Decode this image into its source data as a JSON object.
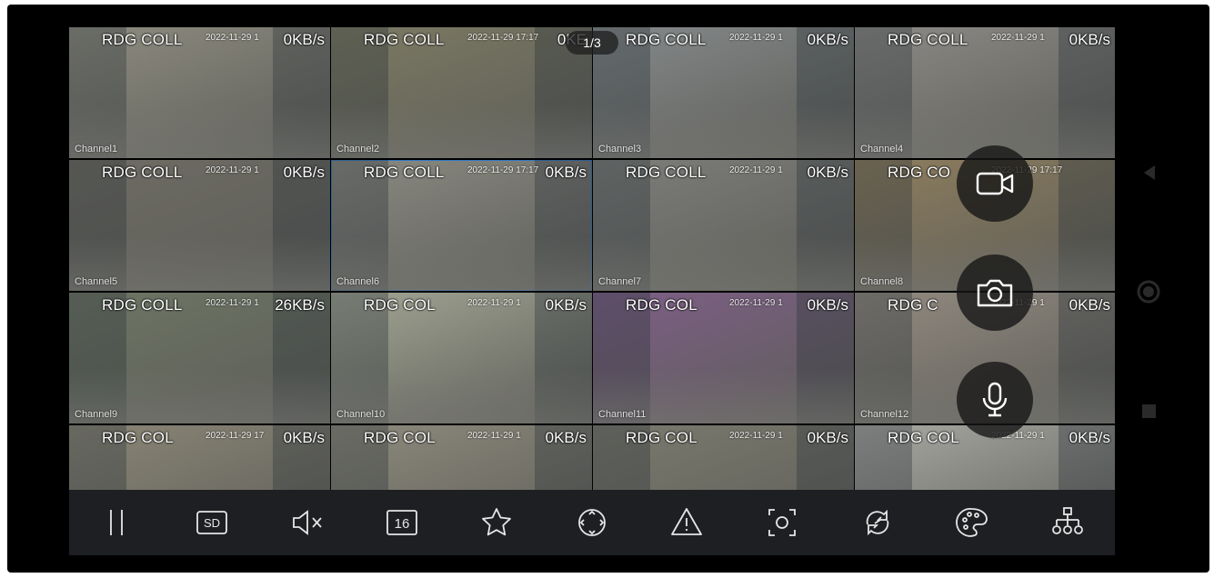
{
  "pager": "1/3",
  "tiles": [
    {
      "name": "RDG COLL",
      "ts": "2022-11-29 1",
      "rate": "0KB/s",
      "channel": "Channel1",
      "bg": "#8e8c80"
    },
    {
      "name": "RDG COLL",
      "ts": "2022-11-29 17:17",
      "rate": "0KE",
      "channel": "Channel2",
      "bg": "#7c7a63"
    },
    {
      "name": "RDG COLL",
      "ts": "2022-11-29 1",
      "rate": "0KB/s",
      "channel": "Channel3",
      "bg": "#85898a"
    },
    {
      "name": "RDG COLL",
      "ts": "2022-11-29 1",
      "rate": "0KB/s",
      "channel": "Channel4",
      "bg": "#8c8a86"
    },
    {
      "name": "RDG COLL",
      "ts": "2022-11-29 1",
      "rate": "0KB/s",
      "channel": "Channel5",
      "bg": "#6e6c63"
    },
    {
      "name": "RDG COLL",
      "ts": "2022-11-29 17:17",
      "rate": "0KB/s",
      "channel": "Channel6",
      "bg": "#8a8a82"
    },
    {
      "name": "RDG COLL",
      "ts": "2022-11-29 1",
      "rate": "0KB/s",
      "channel": "Channel7",
      "bg": "#7d7e7a"
    },
    {
      "name": "RDG CO",
      "ts": "2022-11-29 17:17",
      "rate": "",
      "channel": "Channel8",
      "bg": "#8d7d5e"
    },
    {
      "name": "RDG COLL",
      "ts": "2022-11-29 1",
      "rate": "26KB/s",
      "channel": "Channel9",
      "bg": "#6d7564"
    },
    {
      "name": "RDG COL",
      "ts": "2022-11-29 1",
      "rate": "0KB/s",
      "channel": "Channel10",
      "bg": "#a2a594"
    },
    {
      "name": "RDG COL",
      "ts": "2022-11-29 1",
      "rate": "0KB/s",
      "channel": "Channel11",
      "bg": "#7d5f86"
    },
    {
      "name": "RDG C",
      "ts": "2022-11-29 1",
      "rate": "0KB/s",
      "channel": "Channel12",
      "bg": "#928a80"
    },
    {
      "name": "RDG COL",
      "ts": "2022-11-29 17",
      "rate": "0KB/s",
      "channel": "",
      "bg": "#8a8676"
    },
    {
      "name": "RDG COL",
      "ts": "2022-11-29 1",
      "rate": "0KB/s",
      "channel": "",
      "bg": "#8d8a7c"
    },
    {
      "name": "RDG COL",
      "ts": "2022-11-29 1",
      "rate": "0KB/s",
      "channel": "",
      "bg": "#7b7a6e"
    },
    {
      "name": "RDG COL",
      "ts": "2022-11-29 1",
      "rate": "0KB/s",
      "channel": "",
      "bg": "#a9a9a4"
    }
  ],
  "selected_tile": 5,
  "float_buttons": [
    "record-video-icon",
    "snapshot-camera-icon",
    "microphone-icon"
  ],
  "toolbar": [
    {
      "icon": "pause-icon",
      "label": ""
    },
    {
      "icon": "sd-quality-icon",
      "label": "SD"
    },
    {
      "icon": "speaker-muted-icon",
      "label": ""
    },
    {
      "icon": "split-16-icon",
      "label": "16"
    },
    {
      "icon": "favorite-star-icon",
      "label": ""
    },
    {
      "icon": "ptz-control-icon",
      "label": ""
    },
    {
      "icon": "alarm-warning-icon",
      "label": ""
    },
    {
      "icon": "fullscreen-capture-icon",
      "label": ""
    },
    {
      "icon": "sync-rotate-icon",
      "label": ""
    },
    {
      "icon": "color-palette-icon",
      "label": ""
    },
    {
      "icon": "device-tree-icon",
      "label": ""
    }
  ],
  "nav": [
    "back-triangle-icon",
    "home-circle-icon",
    "recents-square-icon"
  ]
}
